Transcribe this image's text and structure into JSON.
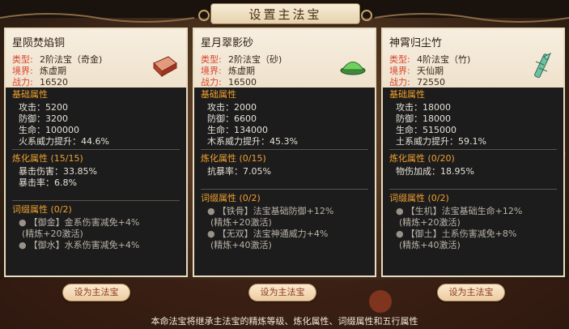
{
  "title": "设置主法宝",
  "cards": [
    {
      "name": "星陨焚焰铜",
      "meta": [
        {
          "key": "类型:",
          "val": "2阶法宝（奇金)"
        },
        {
          "key": "境界:",
          "val": "炼虚期"
        },
        {
          "key": "战力:",
          "val": "16520"
        }
      ],
      "icon": "copper-ingot-icon",
      "base_title": "基础属性",
      "base": [
        "攻击：5200",
        "防御：3200",
        "生命：100000",
        "火系威力提升：44.6%"
      ],
      "refine_title": "炼化属性 (15/15)",
      "refine": [
        "暴击伤害：33.85%",
        "暴击率：6.8%"
      ],
      "affix_title": "词缀属性 (0/2)",
      "affix": [
        "【御金】金系伤害减免+4%",
        "(精炼+20激活)",
        "【御水】水系伤害减免+4%"
      ],
      "button": "设为主法宝"
    },
    {
      "name": "星月翠影砂",
      "meta": [
        {
          "key": "类型:",
          "val": "2阶法宝（砂)"
        },
        {
          "key": "境界:",
          "val": "炼虚期"
        },
        {
          "key": "战力:",
          "val": "16500"
        }
      ],
      "icon": "green-sand-icon",
      "base_title": "基础属性",
      "base": [
        "攻击：2000",
        "防御：6600",
        "生命：134000",
        "木系威力提升：45.3%"
      ],
      "refine_title": "炼化属性 (0/15)",
      "refine": [
        "抗暴率：7.05%"
      ],
      "affix_title": "词缀属性 (0/2)",
      "affix": [
        "【铁骨】法宝基础防御+12%",
        "(精炼+20激活)",
        "【无双】法宝神通威力+4%",
        "(精炼+40激活)"
      ],
      "button": "设为主法宝"
    },
    {
      "name": "神霄归尘竹",
      "meta": [
        {
          "key": "类型:",
          "val": "4阶法宝（竹)"
        },
        {
          "key": "境界:",
          "val": "天仙期"
        },
        {
          "key": "战力:",
          "val": "72550"
        }
      ],
      "icon": "bamboo-icon",
      "base_title": "基础属性",
      "base": [
        "攻击：18000",
        "防御：18000",
        "生命：515000",
        "土系威力提升：59.1%"
      ],
      "refine_title": "炼化属性 (0/20)",
      "refine": [
        "物伤加成：18.95%"
      ],
      "affix_title": "词缀属性 (0/2)",
      "affix": [
        "【生机】法宝基础生命+12%",
        "(精炼+20激活)",
        "【御土】土系伤害减免+8%",
        "(精炼+40激活)"
      ],
      "button": "设为主法宝"
    }
  ],
  "footer": "本命法宝将继承主法宝的精炼等级、炼化属性、词缀属性和五行属性"
}
